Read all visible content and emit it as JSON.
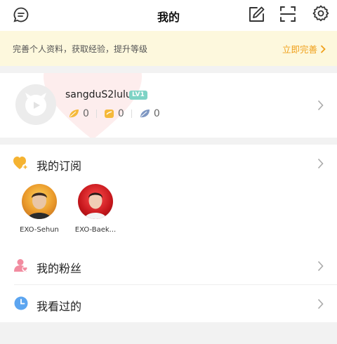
{
  "header": {
    "title": "我的"
  },
  "banner": {
    "text": "完善个人资料，获取经验，提升等级",
    "action": "立即完善"
  },
  "profile": {
    "username": "sangduS2lulu",
    "level": "LV1",
    "stats": [
      {
        "icon": "gold-leaf-icon",
        "value": "0"
      },
      {
        "icon": "ticket-icon",
        "value": "0"
      },
      {
        "icon": "feather-icon",
        "value": "0"
      }
    ]
  },
  "subscriptions": {
    "label": "我的订阅",
    "items": [
      {
        "name": "EXO-Sehun"
      },
      {
        "name": "EXO-Baek..."
      }
    ]
  },
  "fans": {
    "label": "我的粉丝"
  },
  "history": {
    "label": "我看过的"
  },
  "colors": {
    "accent": "#f0a01a",
    "banner_bg": "#fdf8dd",
    "level_badge": "#7ed3c5",
    "fans_icon": "#f28ca0",
    "history_icon": "#5ca5f0"
  }
}
